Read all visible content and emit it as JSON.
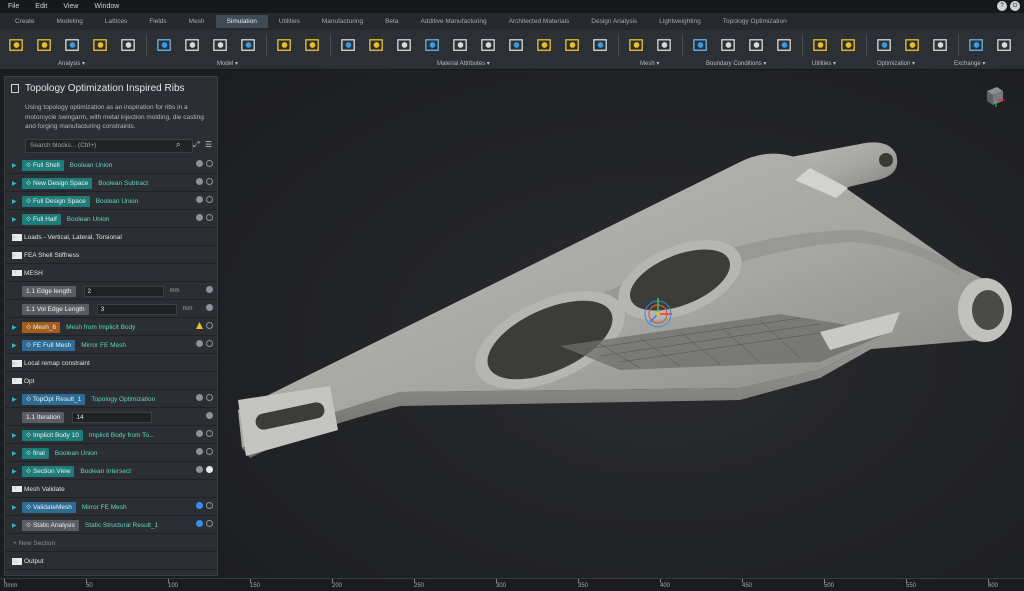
{
  "menu": [
    "File",
    "Edit",
    "View",
    "Window"
  ],
  "window_buttons": [
    "?",
    "⏻"
  ],
  "tabs": [
    "Create",
    "Modeling",
    "Lattices",
    "Fields",
    "Mesh",
    "Simulation",
    "Utilities",
    "Manufacturing",
    "Beta",
    "Additive Manufacturing",
    "Architected Materials",
    "Design Analysis",
    "Lightweighting",
    "Topology Optimization"
  ],
  "active_tab": "Simulation",
  "toolbar_groups": [
    "Analysis ▾",
    "Model ▾",
    "Material Attributes ▾",
    "Mesh ▾",
    "Boundary Conditions ▾",
    "Utilities ▾",
    "Optimization ▾",
    "Exchange ▾"
  ],
  "panel": {
    "title": "Topology Optimization Inspired Ribs",
    "description": "Using topology optimization as an inspiration for ribs in a motorcycle swingarm, with metal injection molding, die casting and forging manufacturing constraints.",
    "search_placeholder": "Search blocks... (Ctrl+)",
    "rows": [
      {
        "kind": "block",
        "name": "Full Shell",
        "op": "Boolean Union",
        "color": "teal",
        "status": [
          "q",
          "o"
        ]
      },
      {
        "kind": "block",
        "name": "New Design Space",
        "op": "Boolean Subtract",
        "color": "teal",
        "status": [
          "q",
          "o"
        ]
      },
      {
        "kind": "block",
        "name": "Full Design Space",
        "op": "Boolean Union",
        "color": "teal",
        "status": [
          "q",
          "o"
        ]
      },
      {
        "kind": "block",
        "name": "Full Half",
        "op": "Boolean Union",
        "color": "teal",
        "status": [
          "q",
          "o"
        ]
      },
      {
        "kind": "section",
        "name": "Loads - Vertical, Lateral, Torsional",
        "open": false
      },
      {
        "kind": "section",
        "name": "FEA Shell Stiffness",
        "open": false
      },
      {
        "kind": "section",
        "name": "MESH",
        "open": true
      },
      {
        "kind": "input",
        "name": "Edge length",
        "value": "2",
        "unit": "mm"
      },
      {
        "kind": "input",
        "name": "Vol Edge Length",
        "value": "3",
        "unit": "mm"
      },
      {
        "kind": "block",
        "name": "Mesh_6",
        "op": "Mesh from Implicit Body",
        "color": "orn",
        "status": [
          "y",
          "o"
        ]
      },
      {
        "kind": "block",
        "name": "FE Full Mesh",
        "op": "Mirror FE Mesh",
        "color": "blu",
        "status": [
          "q",
          "o"
        ]
      },
      {
        "kind": "section",
        "name": "Local remap constraint",
        "open": false
      },
      {
        "kind": "section",
        "name": "Opt",
        "open": true
      },
      {
        "kind": "block",
        "name": "TopOpt Result_1",
        "op": "Topology Optimization",
        "color": "blu",
        "status": [
          "q",
          "o"
        ]
      },
      {
        "kind": "input",
        "name": "Iteration",
        "value": "14",
        "unit": ""
      },
      {
        "kind": "block",
        "name": "Implicit Body 10",
        "op": "Implicit Body from To...",
        "color": "teal",
        "status": [
          "q",
          "o"
        ]
      },
      {
        "kind": "block",
        "name": "final",
        "op": "Boolean Union",
        "color": "teal",
        "status": [
          "q",
          "o"
        ]
      },
      {
        "kind": "block",
        "name": "Section View",
        "op": "Boolean Intersect",
        "color": "teal",
        "status": [
          "q",
          "w"
        ]
      },
      {
        "kind": "section",
        "name": "Mesh Validate",
        "open": true
      },
      {
        "kind": "block",
        "name": "ValidateMesh",
        "op": "Mirror FE Mesh",
        "color": "blu",
        "status": [
          "b",
          "o"
        ]
      },
      {
        "kind": "block",
        "name": "Static Analysis",
        "op": "Static Structural Result_1",
        "color": "gry",
        "status": [
          "b",
          "o"
        ]
      },
      {
        "kind": "new",
        "name": "+ New Section"
      },
      {
        "kind": "output",
        "name": "Output"
      }
    ]
  },
  "ruler": {
    "unit": "mm",
    "ticks": [
      "0",
      "50",
      "100",
      "150",
      "200",
      "250",
      "300",
      "350",
      "400",
      "450",
      "500",
      "550",
      "600"
    ]
  }
}
